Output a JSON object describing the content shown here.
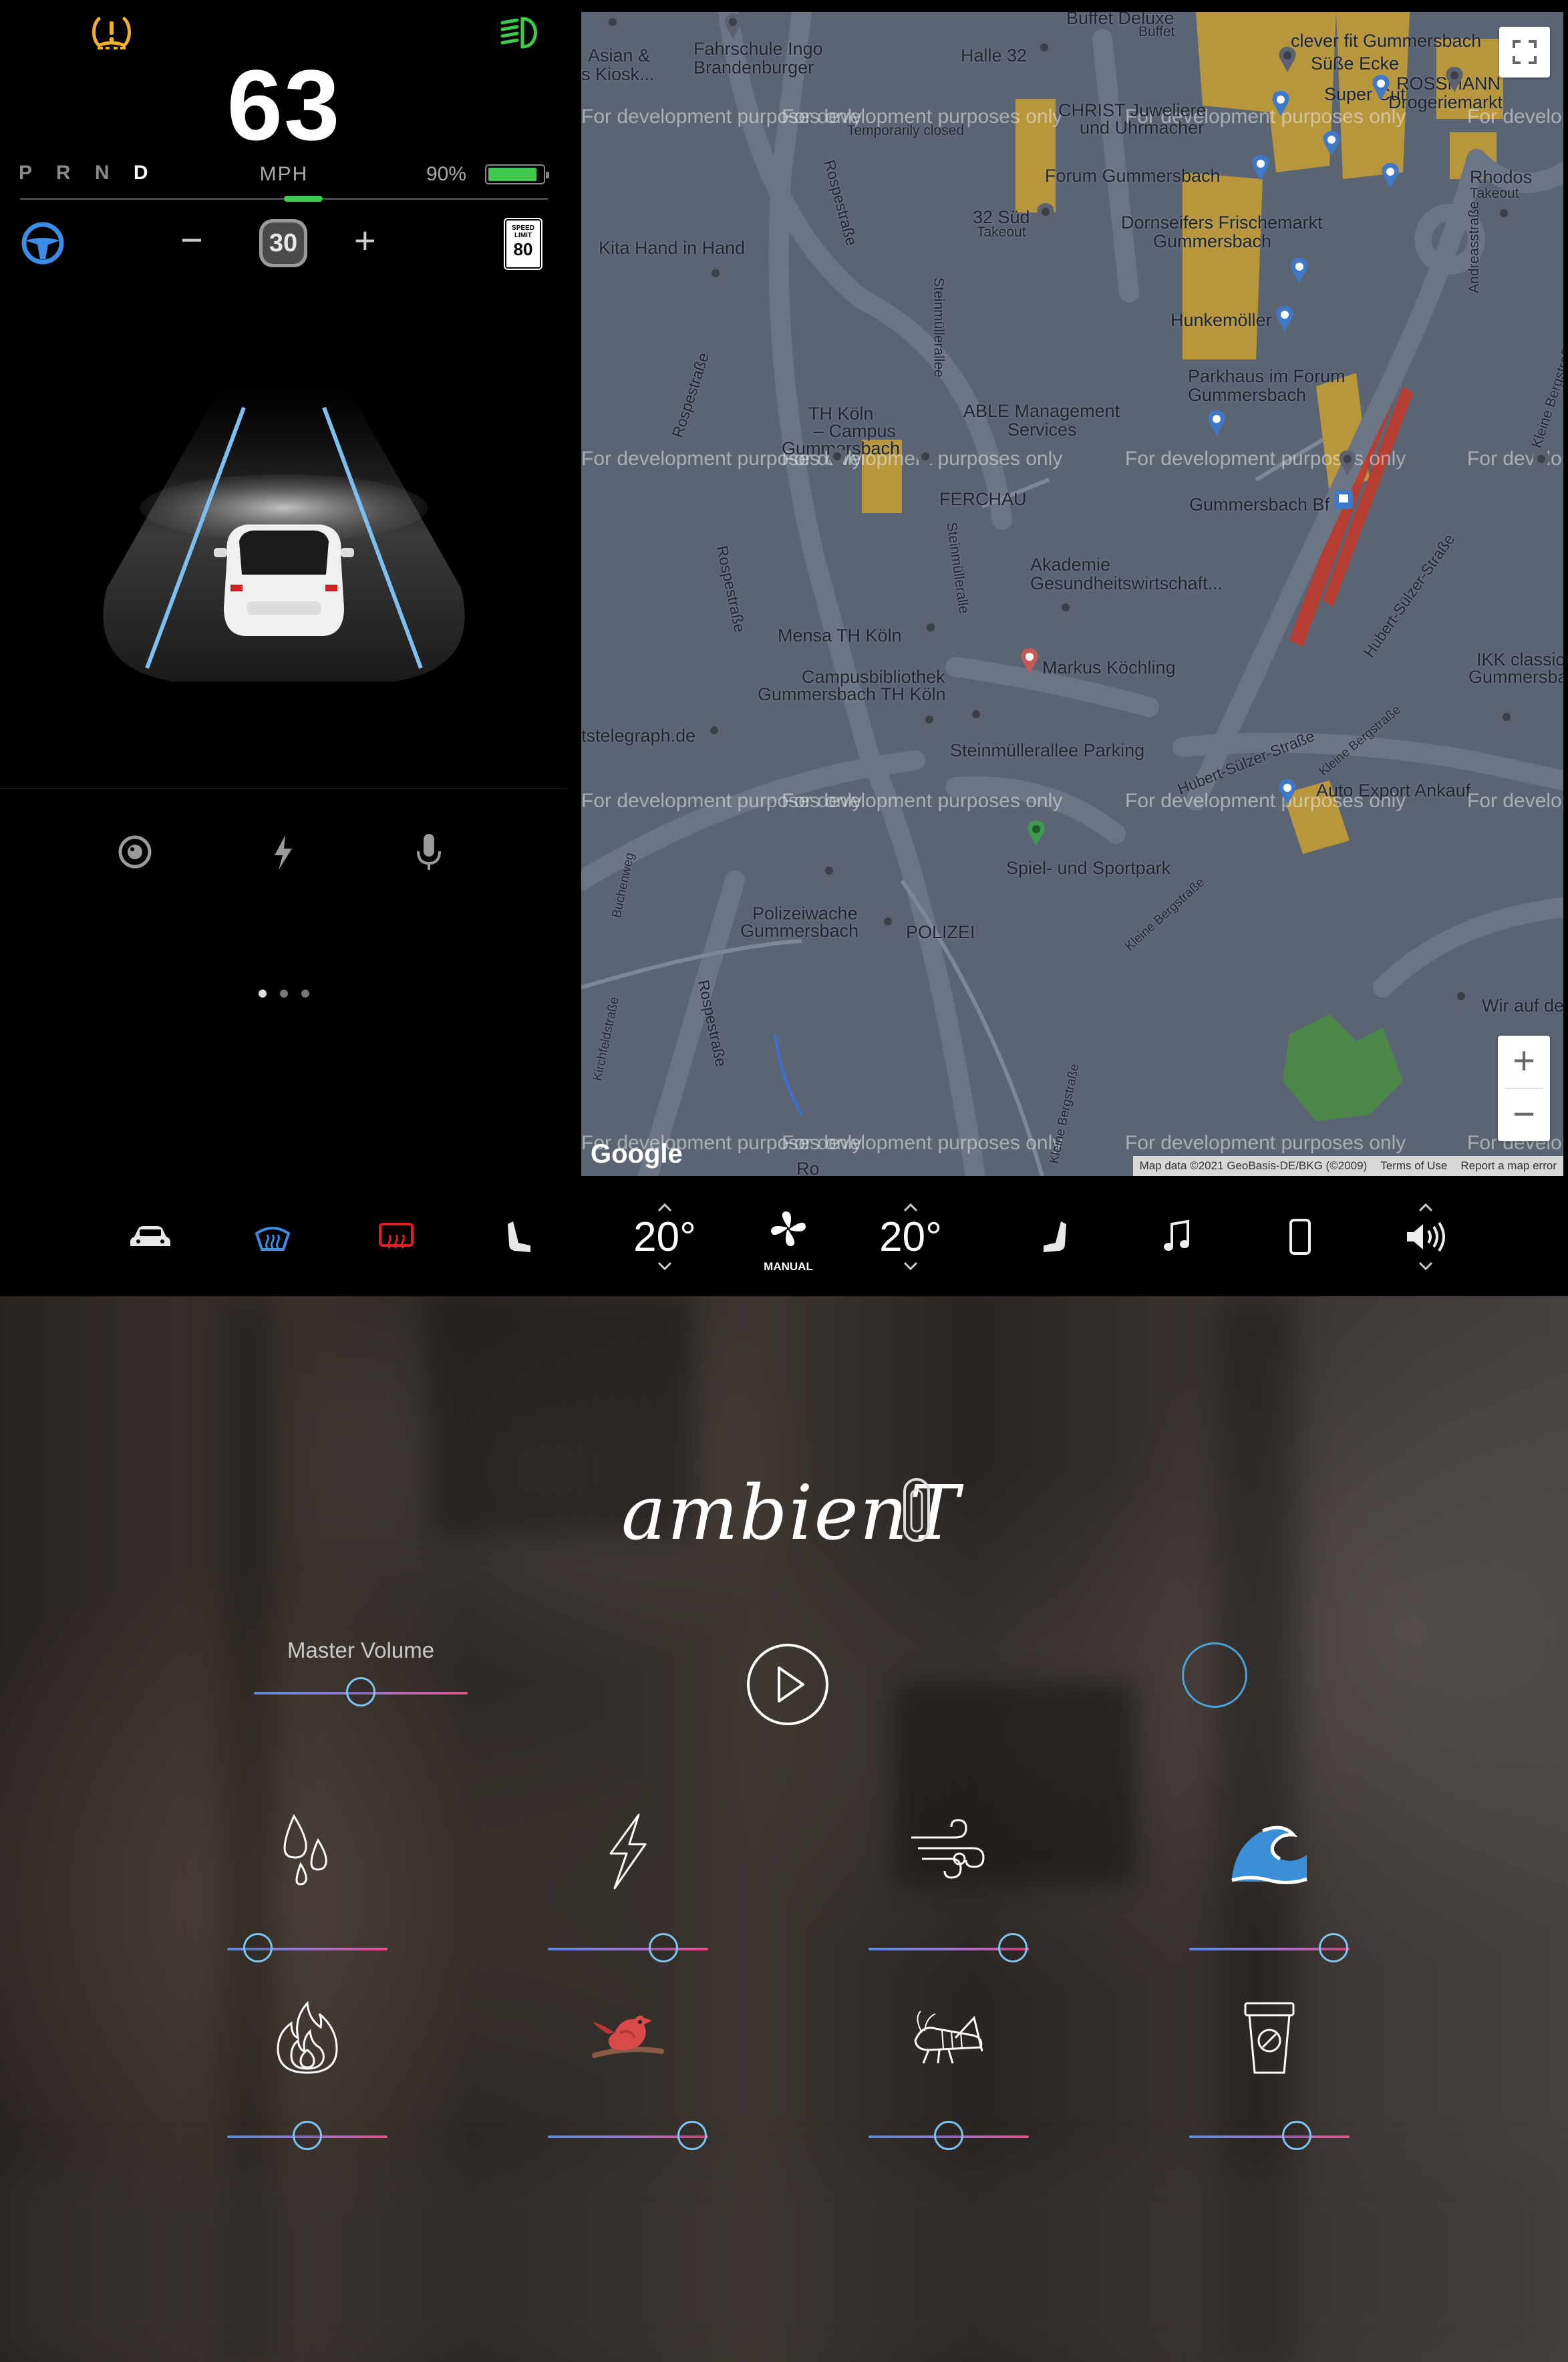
{
  "instrument": {
    "speed": "63",
    "speed_unit": "MPH",
    "gears": [
      "P",
      "R",
      "N",
      "D"
    ],
    "active_gear": "D",
    "battery_percent": "90%",
    "battery_level": 0.9,
    "cruise_minus": "−",
    "cruise_speed": "30",
    "cruise_plus": "+",
    "speed_limit_label": "SPEED LIMIT",
    "speed_limit_value": "80",
    "icons": [
      "tire-pressure-warning-icon",
      "headlight-icon",
      "autopilot-steering-icon",
      "camera-icon",
      "bolt-icon",
      "microphone-icon"
    ],
    "page_dots": 3,
    "active_page": 0
  },
  "map": {
    "labels": [
      "Buffet Deluxe",
      "Buffet",
      "clever fit Gummersbach",
      "Asian &",
      "s Kiosk...",
      "Fahrschule Ingo",
      "Brandenburger",
      "Halle 32",
      "Süße Ecke",
      "ROSSMANN",
      "Drogeriemarkt",
      "Super Cut",
      "CHRIST Juweliere",
      "und Uhrmacher",
      "Temporarily closed",
      "Rospestraße",
      "Forum Gummersbach",
      "Rhodos",
      "Takeout",
      "32 Süd",
      "Takeout",
      "Dornseifers Frischemarkt",
      "Gummersbach",
      "Kita Hand in Hand",
      "Steinmüllerallee",
      "Hunkemöller",
      "Parkhaus im Forum",
      "Gummersbach",
      "Andreasstraße",
      "Kleine Bergstraße",
      "Rospestraße",
      "TH Köln",
      "– Campus",
      "Gummersbach",
      "ABLE Management",
      "Services",
      "FERCHAU",
      "Gummersbach Bf",
      "Rospestraße",
      "Steinmülleralle",
      "Akademie",
      "Gesundheitswirtschaft...",
      "Hubert-Sülzer-Straße",
      "Mensa TH Köln",
      "Markus Köchling",
      "IKK classic",
      "Gummersbach",
      "Campusbibliothek",
      "Gummersbach TH Köln",
      "tstelegraph.de",
      "Steinmüllerallee Parking",
      "Hubert-Sülzer-Straße",
      "Auto Export Ankauf",
      "Kleine Bergstraße",
      "Spiel- und Sportpark",
      "Buchenweg",
      "Polizeiwache",
      "Gummersbach",
      "POLIZEI",
      "Kleine Bergstraße",
      "Kirchfeldstraße",
      "Rospestraße",
      "Wir auf de",
      "Kleine Bergstraße",
      "Ro"
    ],
    "watermark": "For development purposes only",
    "google": "Google",
    "attribution": [
      "Map data ©2021 GeoBasis-DE/BKG (©2009)",
      "Terms of Use",
      "Report a map error"
    ],
    "zoom_in": "+",
    "zoom_out": "−"
  },
  "climate": {
    "left_temp": "20°",
    "right_temp": "20°",
    "fan_mode": "MANUAL",
    "icons": [
      "car-icon",
      "front-defrost-icon",
      "rear-defrost-icon",
      "left-seat-heater-icon",
      "fan-icon",
      "right-seat-heater-icon",
      "music-icon",
      "phone-icon",
      "volume-icon"
    ],
    "colors": {
      "front_defrost": "#3b8ee8",
      "rear_defrost": "#e02020"
    }
  },
  "ambient": {
    "title": "ambienT",
    "master_volume_label": "Master Volume",
    "master_volume": 0.5,
    "sounds": [
      {
        "name": "rain",
        "icon": "rain-drops-icon",
        "level": 0.19
      },
      {
        "name": "thunder",
        "icon": "lightning-icon",
        "level": 0.72
      },
      {
        "name": "wind",
        "icon": "wind-icon",
        "level": 0.9
      },
      {
        "name": "waves",
        "icon": "wave-icon",
        "level": 0.9
      },
      {
        "name": "fire",
        "icon": "fire-icon",
        "level": 0.5
      },
      {
        "name": "birds",
        "icon": "bird-icon",
        "level": 0.9
      },
      {
        "name": "crickets",
        "icon": "cricket-icon",
        "level": 0.5
      },
      {
        "name": "coffee shop",
        "icon": "coffee-cup-icon",
        "level": 0.67
      }
    ],
    "slider_colors": {
      "start": "#5a8de0",
      "end": "#e8508a",
      "thumb": "#7cc7f2"
    }
  }
}
